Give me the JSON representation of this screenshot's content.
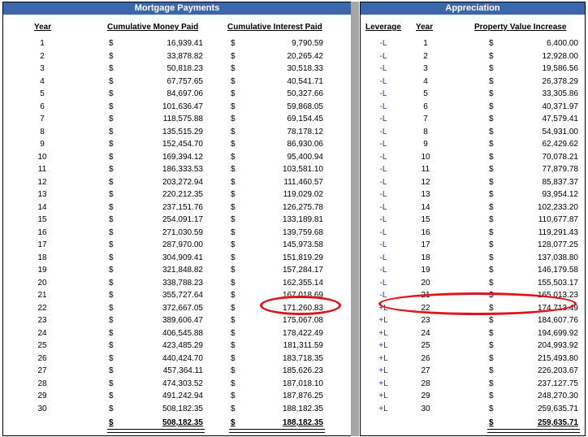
{
  "left_title": "Mortgage Payments",
  "right_title": "Appreciation",
  "headers": {
    "year": "Year",
    "cum_money": "Cumulative Money Paid",
    "cum_interest": "Cumulative Interest Paid",
    "leverage": "Leverage",
    "year2": "Year",
    "prop_value": "Property Value Increase"
  },
  "currency": "$",
  "rows": [
    {
      "year": "1",
      "money": "16,939.41",
      "interest": "9,790.59",
      "lev": "-L",
      "prop": "6,400.00"
    },
    {
      "year": "2",
      "money": "33,878.82",
      "interest": "20,265.42",
      "lev": "-L",
      "prop": "12,928.00"
    },
    {
      "year": "3",
      "money": "50,818.23",
      "interest": "30,518.33",
      "lev": "-L",
      "prop": "19,586.56"
    },
    {
      "year": "4",
      "money": "67,757.65",
      "interest": "40,541.71",
      "lev": "-L",
      "prop": "26,378.29"
    },
    {
      "year": "5",
      "money": "84,697.06",
      "interest": "50,327.66",
      "lev": "-L",
      "prop": "33,305.86"
    },
    {
      "year": "6",
      "money": "101,636.47",
      "interest": "59,868.05",
      "lev": "-L",
      "prop": "40,371.97"
    },
    {
      "year": "7",
      "money": "118,575.88",
      "interest": "69,154.45",
      "lev": "-L",
      "prop": "47,579.41"
    },
    {
      "year": "8",
      "money": "135,515.29",
      "interest": "78,178.12",
      "lev": "-L",
      "prop": "54,931.00"
    },
    {
      "year": "9",
      "money": "152,454.70",
      "interest": "86,930.06",
      "lev": "-L",
      "prop": "62,429.62"
    },
    {
      "year": "10",
      "money": "169,394.12",
      "interest": "95,400.94",
      "lev": "-L",
      "prop": "70,078.21"
    },
    {
      "year": "11",
      "money": "186,333.53",
      "interest": "103,581.10",
      "lev": "-L",
      "prop": "77,879.78"
    },
    {
      "year": "12",
      "money": "203,272.94",
      "interest": "111,460.57",
      "lev": "-L",
      "prop": "85,837.37"
    },
    {
      "year": "13",
      "money": "220,212.35",
      "interest": "119,029.02",
      "lev": "-L",
      "prop": "93,954.12"
    },
    {
      "year": "14",
      "money": "237,151.76",
      "interest": "126,275.78",
      "lev": "-L",
      "prop": "102,233.20"
    },
    {
      "year": "15",
      "money": "254,091.17",
      "interest": "133,189.81",
      "lev": "-L",
      "prop": "110,677.87"
    },
    {
      "year": "16",
      "money": "271,030.59",
      "interest": "139,759.68",
      "lev": "-L",
      "prop": "119,291.43"
    },
    {
      "year": "17",
      "money": "287,970.00",
      "interest": "145,973.58",
      "lev": "-L",
      "prop": "128,077.25"
    },
    {
      "year": "18",
      "money": "304,909.41",
      "interest": "151,819.29",
      "lev": "-L",
      "prop": "137,038.80"
    },
    {
      "year": "19",
      "money": "321,848.82",
      "interest": "157,284.17",
      "lev": "-L",
      "prop": "146,179.58"
    },
    {
      "year": "20",
      "money": "338,788.23",
      "interest": "162,355.14",
      "lev": "-L",
      "prop": "155,503.17"
    },
    {
      "year": "21",
      "money": "355,727.64",
      "interest": "167,018.69",
      "lev": "-L",
      "prop": "165,013.23"
    },
    {
      "year": "22",
      "money": "372,667.05",
      "interest": "171,260.83",
      "lev": "+L",
      "prop": "174,713.49"
    },
    {
      "year": "23",
      "money": "389,606.47",
      "interest": "175,067.08",
      "lev": "+L",
      "prop": "184,607.76"
    },
    {
      "year": "24",
      "money": "406,545.88",
      "interest": "178,422.49",
      "lev": "+L",
      "prop": "194,699.92"
    },
    {
      "year": "25",
      "money": "423,485.29",
      "interest": "181,311.59",
      "lev": "+L",
      "prop": "204,993.92"
    },
    {
      "year": "26",
      "money": "440,424.70",
      "interest": "183,718.35",
      "lev": "+L",
      "prop": "215,493.80"
    },
    {
      "year": "27",
      "money": "457,364.11",
      "interest": "185,626.23",
      "lev": "+L",
      "prop": "226,203.67"
    },
    {
      "year": "28",
      "money": "474,303.52",
      "interest": "187,018.10",
      "lev": "+L",
      "prop": "237,127.75"
    },
    {
      "year": "29",
      "money": "491,242.94",
      "interest": "187,876.25",
      "lev": "+L",
      "prop": "248,270.30"
    },
    {
      "year": "30",
      "money": "508,182.35",
      "interest": "188,182.35",
      "lev": "+L",
      "prop": "259,635.71"
    }
  ],
  "totals": {
    "money": "508,182.35",
    "interest": "188,182.35",
    "prop": "259,635.71"
  },
  "colors": {
    "banner": "#3c68ab",
    "highlight": "#e0141c",
    "leverage_text": "#1f3a93",
    "divider": "#a6a6a6"
  }
}
